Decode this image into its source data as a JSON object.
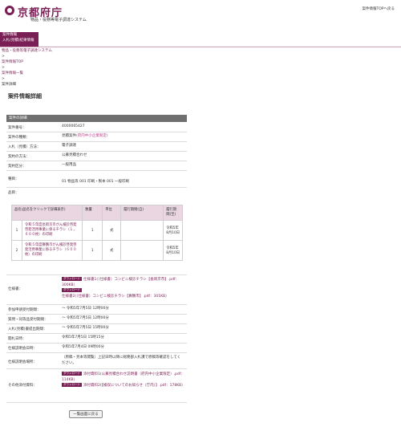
{
  "header": {
    "logo_text": "京都府庁",
    "system_name": "物品・役務等電子調達システム",
    "top_link": "案件情報TOPへ戻る"
  },
  "nav": {
    "items": [
      "案件情報",
      "入札(見積)結果情報"
    ]
  },
  "breadcrumb": {
    "items": [
      "物品・役務等電子調達システム",
      ">",
      "案件情報TOP",
      ">",
      "案件情報一覧",
      ">",
      "案件詳細"
    ]
  },
  "page_title": "案件情報詳細",
  "section_title": "案件の詳細",
  "details": {
    "case_number_label": "案件番号：",
    "case_number": "4000065427",
    "case_type_label": "案件の種類：",
    "case_type": "見積案件",
    "case_type_note": "(府内中小企業限定)",
    "bid_method_label": "入札（見積）方法：",
    "bid_method": "電子調達",
    "contract_method_label": "契約の方法：",
    "contract_method": "公募見積合わせ",
    "contract_category_label": "契約区分：",
    "contract_category": "一般用品",
    "subject_label": "種目：",
    "subject": "01  物品等  001  印刷・製本  001  一般印刷",
    "items_label": "品目："
  },
  "items_table": {
    "headers": [
      "品名(品名をクリックで詳細表示)",
      "数量",
      "単位",
      "履行期間(自)",
      "履行期間(至)"
    ],
    "rows": [
      {
        "no": "1",
        "name": "令和５年度長岡京市がん検診啓発啓発活用事業に係るチラシ（１，６００枚）の印刷",
        "qty": "1",
        "unit": "式",
        "from": "",
        "to": "令和5年8月10日"
      },
      {
        "no": "2",
        "name": "令和５年度舞鶴市がん検診啓発啓発活用事業に係るチラシ（６００枚）の印刷",
        "qty": "1",
        "unit": "式",
        "from": "",
        "to": "令和5年8月10日"
      }
    ]
  },
  "spec": {
    "label": "仕様書：",
    "badge": "ダウンロード",
    "files": [
      "仕様書1(（仕様書）コンビニ検診チラシ【長岡京市】.pdf：300KB）",
      "仕様書2(（仕様書）コンビニ検診チラシ【舞鶴市】.pdf：301KB）"
    ]
  },
  "dates": [
    {
      "label": "参加申請受付期間：",
      "value": "～ 令和5年7月5日 12時00分"
    },
    {
      "label": "質問・同等品受付期間：",
      "value": "～ 令和5年7月5日 12時00分"
    },
    {
      "label": "入札(見積)書提出期間：",
      "value": "～ 令和5年7月5日 15時00分"
    },
    {
      "label": "開札日時：",
      "value": "令和5年7月5日 15時15分"
    },
    {
      "label": "仕様説明会日時：",
      "value": "令和5年7月4日 09時00分"
    }
  ],
  "venue": {
    "label": "仕様説明会場所：",
    "value": "（原稿・見本等閲覧）上記日時以降に総務部入札課で原稿等確認をしてください。"
  },
  "other": {
    "label": "その他添付資料：",
    "badge": "ダウンロード",
    "files": [
      "添付資料1(公募見積合わせ説明書（府内中小企業限定）.pdf：114KB）",
      "添付資料2(【検収についてのお知らせ（庁内）】.pdf：178KB）"
    ]
  },
  "back_button": "一覧画面に戻る"
}
